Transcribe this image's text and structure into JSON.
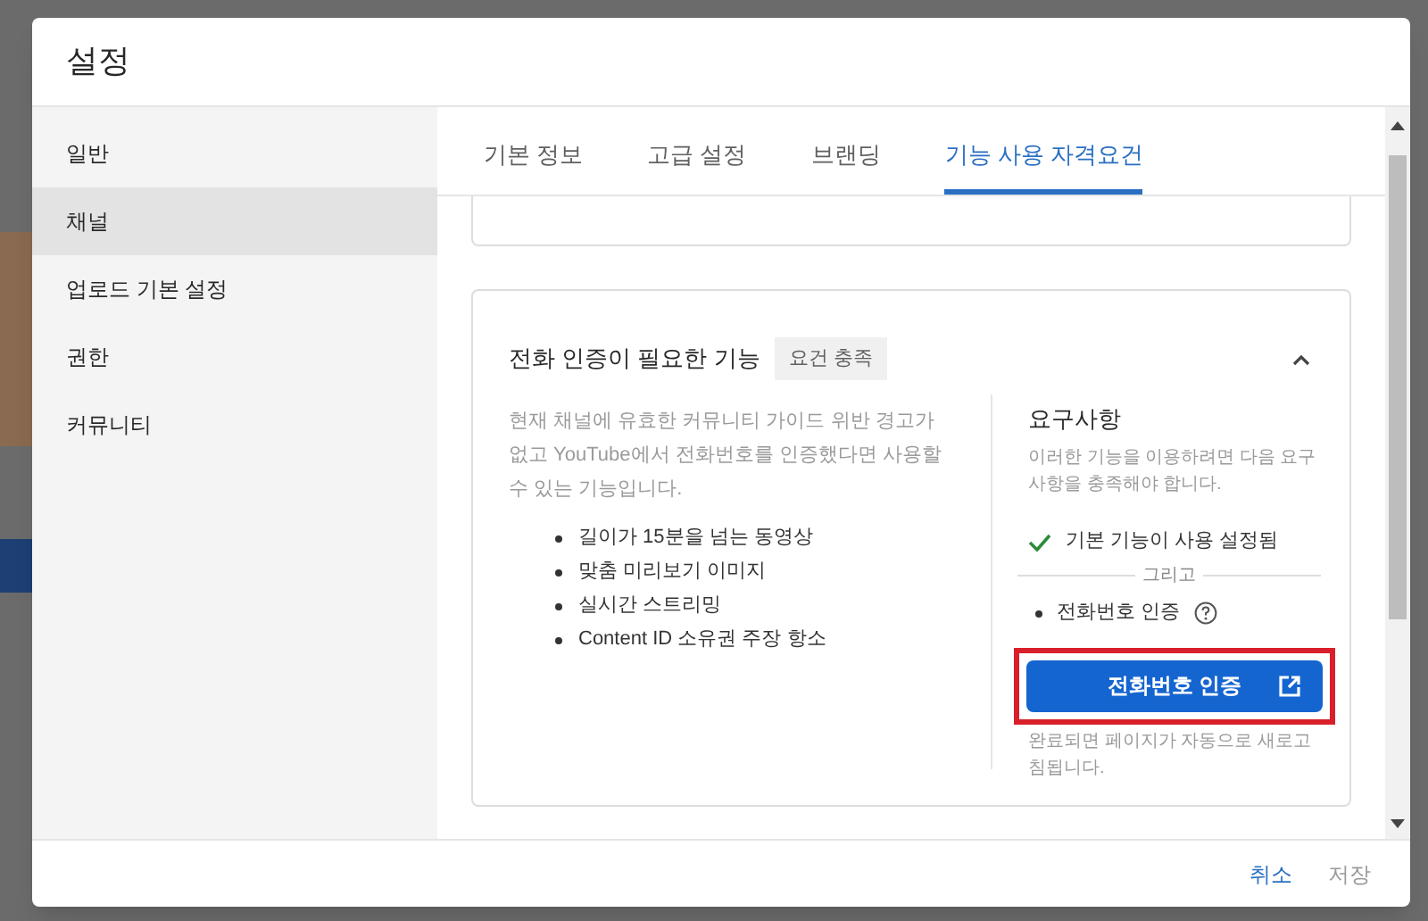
{
  "dialog": {
    "title": "설정"
  },
  "sidebar": {
    "items": [
      {
        "label": "일반",
        "selected": false
      },
      {
        "label": "채널",
        "selected": true
      },
      {
        "label": "업로드 기본 설정",
        "selected": false
      },
      {
        "label": "권한",
        "selected": false
      },
      {
        "label": "커뮤니티",
        "selected": false
      }
    ]
  },
  "tabs": [
    {
      "label": "기본 정보",
      "selected": false
    },
    {
      "label": "고급 설정",
      "selected": false
    },
    {
      "label": "브랜딩",
      "selected": false
    },
    {
      "label": "기능 사용 자격요건",
      "selected": true
    }
  ],
  "feature_card": {
    "title": "전화 인증이 필요한 기능",
    "badge": "요건 충족",
    "expanded": true,
    "description": "현재 채널에 유효한 커뮤니티 가이드 위반 경고가 없고 YouTube에서 전화번호를 인증했다면 사용할 수 있는 기능입니다.",
    "features": [
      "길이가 15분을 넘는 동영상",
      "맞춤 미리보기 이미지",
      "실시간 스트리밍",
      "Content ID 소유권 주장 항소"
    ],
    "requirements": {
      "title": "요구사항",
      "description": "이러한 기능을 이용하려면 다음 요구사항을 충족해야 합니다.",
      "items": [
        {
          "kind": "met",
          "label": "기본 기능이 사용 설정됨"
        },
        {
          "kind": "separator",
          "label": "그리고"
        },
        {
          "kind": "pending",
          "label": "전화번호 인증"
        }
      ],
      "button": {
        "label": "전화번호 인증",
        "highlighted": true
      },
      "note": "완료되면 페이지가 자동으로 새로고침됩니다."
    }
  },
  "footer": {
    "buttons": [
      {
        "label": "취소",
        "disabled": false
      },
      {
        "label": "저장",
        "disabled": true
      }
    ]
  }
}
